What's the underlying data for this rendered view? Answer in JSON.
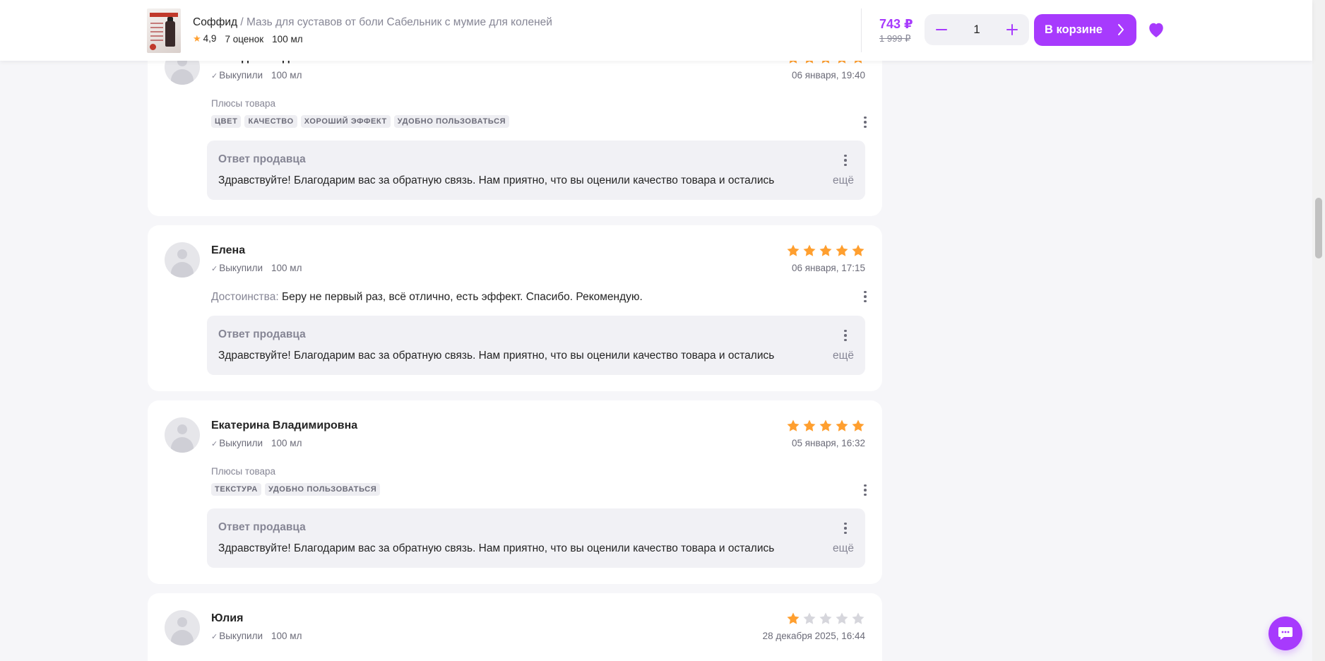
{
  "header": {
    "brand": "Соффид",
    "separator": "/",
    "product_name": "Мазь для суставов от боли Сабельник с мумие для коленей",
    "rating": "4,9",
    "ratings_count": "7 оценок",
    "volume": "100 мл",
    "price": "743 ₽",
    "old_price": "1 999 ₽",
    "quantity": "1",
    "cart_label": "В корзине"
  },
  "colors": {
    "accent": "#a73afd",
    "star": "#ff9f2f",
    "star_empty": "#d6d6dc"
  },
  "reviews": [
    {
      "author": "Мамед Мамедов",
      "bought": "Выкупили",
      "volume": "100 мл",
      "date": "06 января, 19:40",
      "rating": 5,
      "plus_label": "Плюсы товара",
      "tags": [
        "Цвет",
        "Качество",
        "Хороший эффект",
        "Удобно пользоваться"
      ],
      "reply_title": "Ответ продавца",
      "reply_text": "Здравствуйте! Благодарим вас за обратную связь. Нам приятно, что вы оценили качество товара и остались",
      "more": "ещё"
    },
    {
      "author": "Елена",
      "bought": "Выкупили",
      "volume": "100 мл",
      "date": "06 января, 17:15",
      "rating": 5,
      "pros_label": "Достоинства:",
      "pros_text": "Беру не первый раз, всё отлично, есть эффект. Спасибо. Рекомендую.",
      "reply_title": "Ответ продавца",
      "reply_text": "Здравствуйте! Благодарим вас за обратную связь. Нам приятно, что вы оценили качество товара и остались",
      "more": "ещё"
    },
    {
      "author": "Екатерина Владимировна",
      "bought": "Выкупили",
      "volume": "100 мл",
      "date": "05 января, 16:32",
      "rating": 5,
      "plus_label": "Плюсы товара",
      "tags": [
        "Текстура",
        "Удобно пользоваться"
      ],
      "reply_title": "Ответ продавца",
      "reply_text": "Здравствуйте! Благодарим вас за обратную связь. Нам приятно, что вы оценили качество товара и остались",
      "more": "ещё"
    },
    {
      "author": "Юлия",
      "bought": "Выкупили",
      "volume": "100 мл",
      "date": "28 декабря 2025, 16:44",
      "rating": 1
    }
  ]
}
